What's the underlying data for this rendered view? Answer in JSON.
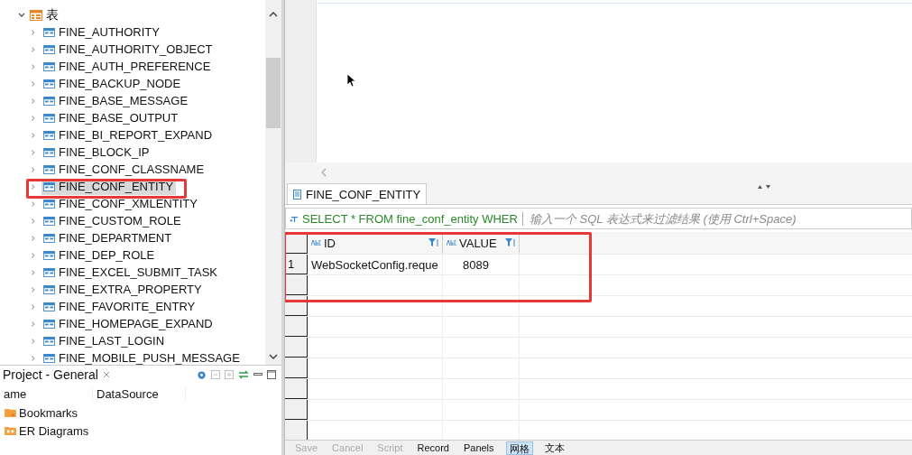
{
  "tree": {
    "label": "表",
    "expanded": true,
    "children": [
      {
        "label": "FINE_AUTHORITY",
        "selected": false
      },
      {
        "label": "FINE_AUTHORITY_OBJECT",
        "selected": false
      },
      {
        "label": "FINE_AUTH_PREFERENCE",
        "selected": false
      },
      {
        "label": "FINE_BACKUP_NODE",
        "selected": false
      },
      {
        "label": "FINE_BASE_MESSAGE",
        "selected": false
      },
      {
        "label": "FINE_BASE_OUTPUT",
        "selected": false
      },
      {
        "label": "FINE_BI_REPORT_EXPAND",
        "selected": false
      },
      {
        "label": "FINE_BLOCK_IP",
        "selected": false
      },
      {
        "label": "FINE_CONF_CLASSNAME",
        "selected": false
      },
      {
        "label": "FINE_CONF_ENTITY",
        "selected": true
      },
      {
        "label": "FINE_CONF_XMLENTITY",
        "selected": false
      },
      {
        "label": "FINE_CUSTOM_ROLE",
        "selected": false
      },
      {
        "label": "FINE_DEPARTMENT",
        "selected": false
      },
      {
        "label": "FINE_DEP_ROLE",
        "selected": false
      },
      {
        "label": "FINE_EXCEL_SUBMIT_TASK",
        "selected": false
      },
      {
        "label": "FINE_EXTRA_PROPERTY",
        "selected": false
      },
      {
        "label": "FINE_FAVORITE_ENTRY",
        "selected": false
      },
      {
        "label": "FINE_HOMEPAGE_EXPAND",
        "selected": false
      },
      {
        "label": "FINE_LAST_LOGIN",
        "selected": false
      },
      {
        "label": "FINE_MOBILE_PUSH_MESSAGE",
        "selected": false
      }
    ]
  },
  "project_panel": {
    "title": "Project - General",
    "columns": [
      "ame",
      "DataSource"
    ],
    "items": [
      {
        "label": "Bookmarks",
        "kind": "bookmarks"
      },
      {
        "label": "ER Diagrams",
        "kind": "diagrams"
      }
    ]
  },
  "results": {
    "tab": "FINE_CONF_ENTITY",
    "query": "SELECT * FROM fine_conf_entity WHER",
    "placeholder": "输入一个 SQL 表达式来过滤结果 (使用 Ctrl+Space)",
    "columns": [
      "ID",
      "VALUE"
    ],
    "rows": [
      {
        "number": "1",
        "cells": [
          "WebSocketConfig.reque",
          "8089"
        ]
      }
    ]
  },
  "toolbar": [
    {
      "label": "Save",
      "disabled": true,
      "selected": false
    },
    {
      "label": "Cancel",
      "disabled": true,
      "selected": false
    },
    {
      "label": "Script",
      "disabled": true,
      "selected": false
    },
    {
      "label": "Record",
      "disabled": false,
      "selected": false
    },
    {
      "label": "Panels",
      "disabled": false,
      "selected": false
    },
    {
      "label": "网格",
      "disabled": false,
      "selected": true
    },
    {
      "label": "文本",
      "disabled": false,
      "selected": false
    }
  ]
}
